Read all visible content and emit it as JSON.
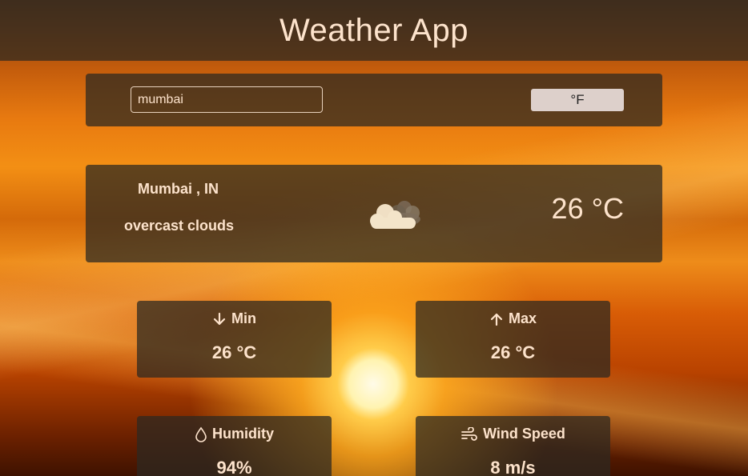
{
  "header": {
    "title": "Weather App"
  },
  "search": {
    "value": "mumbai",
    "unit_toggle_label": "°F"
  },
  "current": {
    "location": "Mumbai , IN",
    "description": "overcast clouds",
    "temperature": "26 °C",
    "icon": "cloud-icon"
  },
  "stats": {
    "min": {
      "label": "Min",
      "value": "26 °C",
      "icon": "arrow-down-icon"
    },
    "max": {
      "label": "Max",
      "value": "26 °C",
      "icon": "arrow-up-icon"
    },
    "humidity": {
      "label": "Humidity",
      "value": "94%",
      "icon": "droplet-icon"
    },
    "wind": {
      "label": "Wind Speed",
      "value": "8 m/s",
      "icon": "wind-icon"
    }
  },
  "colors": {
    "text": "#fde3cc",
    "panel": "#2d2820",
    "button": "#ddd0cb"
  }
}
